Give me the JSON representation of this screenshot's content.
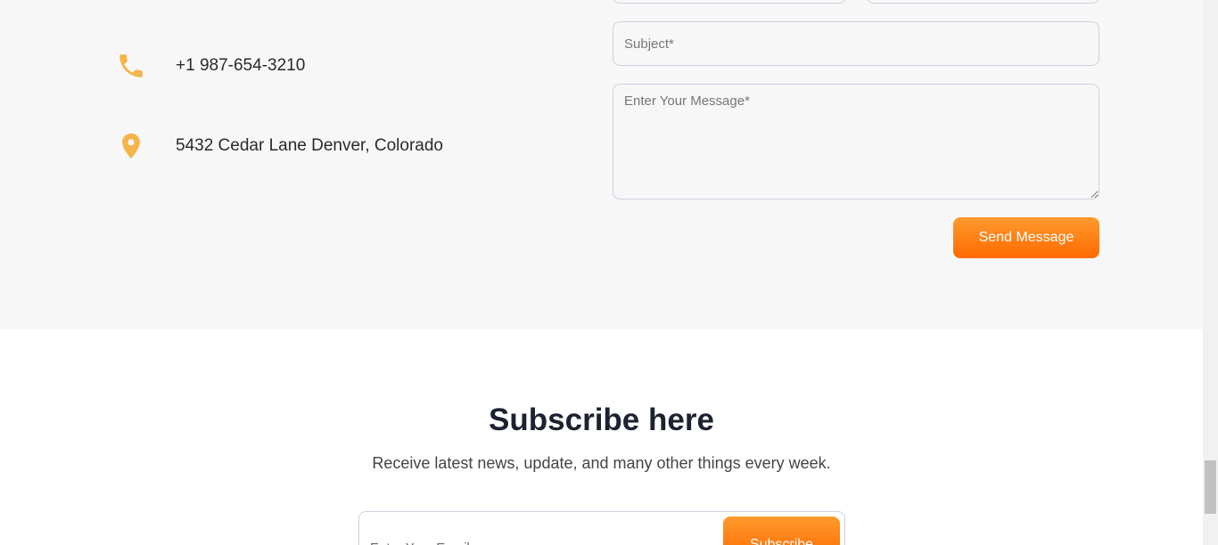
{
  "contact": {
    "phone": "+1 987-654-3210",
    "phone_icon": "phone-icon",
    "address": "5432 Cedar Lane Denver, Colorado",
    "address_icon": "map-pin-icon",
    "icon_color": "#f4b44a"
  },
  "form": {
    "subject_placeholder": "Subject*",
    "message_placeholder": "Enter Your Message*",
    "send_label": "Send Message",
    "accent": "#ff7a10"
  },
  "subscribe": {
    "title": "Subscribe here",
    "subtitle": "Receive latest news, update, and many other things every week.",
    "email_placeholder": "Enter Your Email",
    "button_label": "Subscribe"
  }
}
